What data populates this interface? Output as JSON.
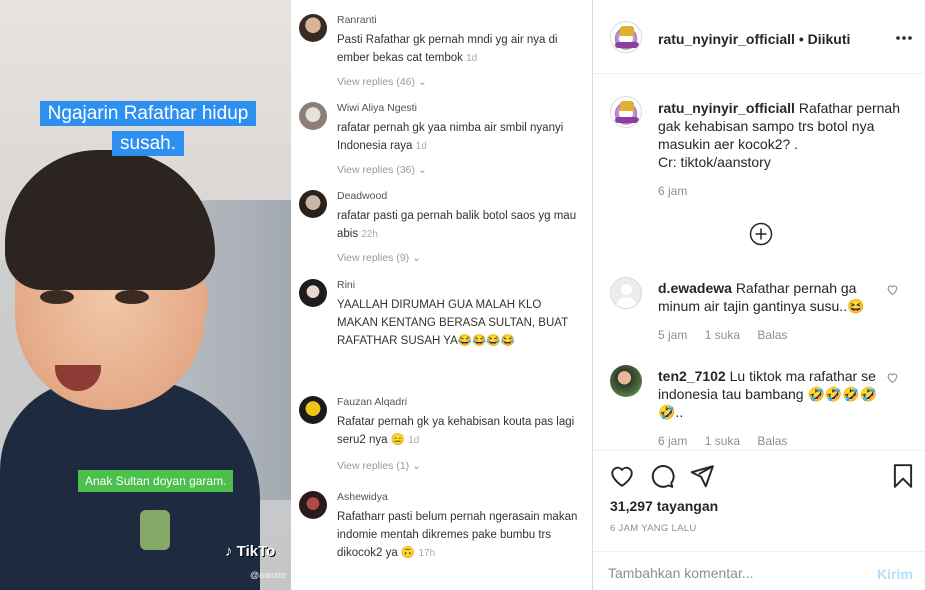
{
  "media": {
    "overlay_caption": "Ngajarin Rafathar hidup susah.",
    "green_caption": "Anak Sultan doyan garam.",
    "tiktok_logo": "TikTo",
    "tiktok_handle": "@aansto",
    "comments": [
      {
        "name": "Ranranti",
        "text": "Pasti Rafathar gk pernah mndi yg air nya di ember bekas cat tembok",
        "time": "1d",
        "replies": "View replies (46)"
      },
      {
        "name": "Wiwi Aliya Ngesti",
        "text": "rafatar pernah gk yaa nimba air smbil nyanyi Indonesia raya",
        "time": "1d",
        "replies": "View replies (36)"
      },
      {
        "name": "Deadwood",
        "text": "rafatar pasti ga pernah balik botol saos yg mau abis",
        "time": "22h",
        "replies": "View replies (9)"
      },
      {
        "name": "Rini",
        "text": "YAALLAH DIRUMAH GUA MALAH KLO MAKAN KENTANG BERASA SULTAN, BUAT RAFATHAR SUSAH YA😂😂😂😂",
        "time": "",
        "replies": ""
      },
      {
        "name": "Fauzan Alqadri",
        "text": "Rafatar pernah gk ya kehabisan kouta pas lagi seru2 nya 😑",
        "time": "1d",
        "replies": "View replies (1)"
      },
      {
        "name": "Ashewidya",
        "text": "Rafatharr pasti belum pernah ngerasain makan indomie mentah dikremes pake bumbu trs dikocok2 ya 🙃",
        "time": "17h",
        "replies": ""
      }
    ]
  },
  "header": {
    "username": "ratu_nyinyir_officiall",
    "separator": "•",
    "follow_status": "Diikuti",
    "more_icon": "more-horizontal-icon"
  },
  "caption": {
    "username": "ratu_nyinyir_officiall",
    "text": "Rafathar pernah gak kehabisan sampo trs botol nya masukin aer kocok2? .",
    "credit": "Cr: tiktok/aanstory",
    "time": "6 jam"
  },
  "comments": [
    {
      "username": "d.ewadewa",
      "text": "Rafathar pernah ga minum air tajin gantinya susu..😆",
      "time": "5 jam",
      "likes": "1 suka",
      "reply": "Balas"
    },
    {
      "username": "ten2_7102",
      "text": "Lu tiktok ma rafathar se indonesia tau bambang 🤣🤣🤣🤣🤣..",
      "time": "6 jam",
      "likes": "1 suka",
      "reply": "Balas"
    }
  ],
  "actions": {
    "views": "31,297 tayangan",
    "ago": "6 JAM YANG LALU"
  },
  "add_comment": {
    "placeholder": "Tambahkan komentar...",
    "post_label": "Kirim"
  }
}
